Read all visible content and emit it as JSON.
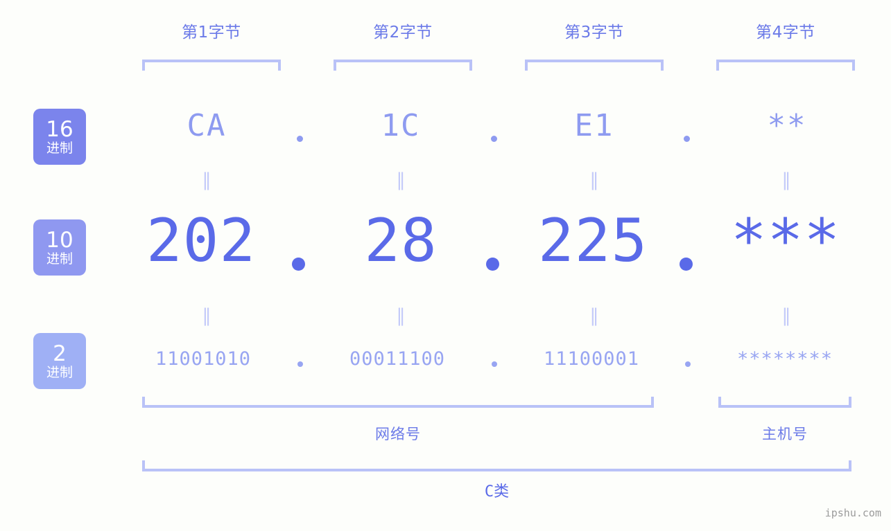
{
  "background_color": "#fdfefb",
  "accent_colors": {
    "badge_hex": "#7b84ec",
    "badge_dec": "#8f98f0",
    "badge_bin": "#9fb0f5",
    "bracket": "#b9c2f7",
    "hex_text": "#8e9bf0",
    "dec_text": "#5a6ae8",
    "bin_text": "#98a5f2",
    "label_text": "#6b7ae8",
    "equals_mark": "#c4cbf9",
    "watermark": "#9b9b9b"
  },
  "byte_headers": [
    {
      "label": "第1字节"
    },
    {
      "label": "第2字节"
    },
    {
      "label": "第3字节"
    },
    {
      "label": "第4字节"
    }
  ],
  "rows": {
    "hex": {
      "badge_number": "16",
      "badge_sub": "进制",
      "values": [
        "CA",
        "1C",
        "E1",
        "**"
      ]
    },
    "decimal": {
      "badge_number": "10",
      "badge_sub": "进制",
      "values": [
        "202",
        "28",
        "225",
        "***"
      ]
    },
    "binary": {
      "badge_number": "2",
      "badge_sub": "进制",
      "values": [
        "11001010",
        "00011100",
        "11100001",
        "********"
      ]
    }
  },
  "separator_dot": ".",
  "equals_mark": "‖",
  "sections": [
    {
      "label": "网络号"
    },
    {
      "label": "主机号"
    }
  ],
  "ip_class": {
    "label": "C类"
  },
  "watermark": {
    "text": "ipshu.com"
  }
}
